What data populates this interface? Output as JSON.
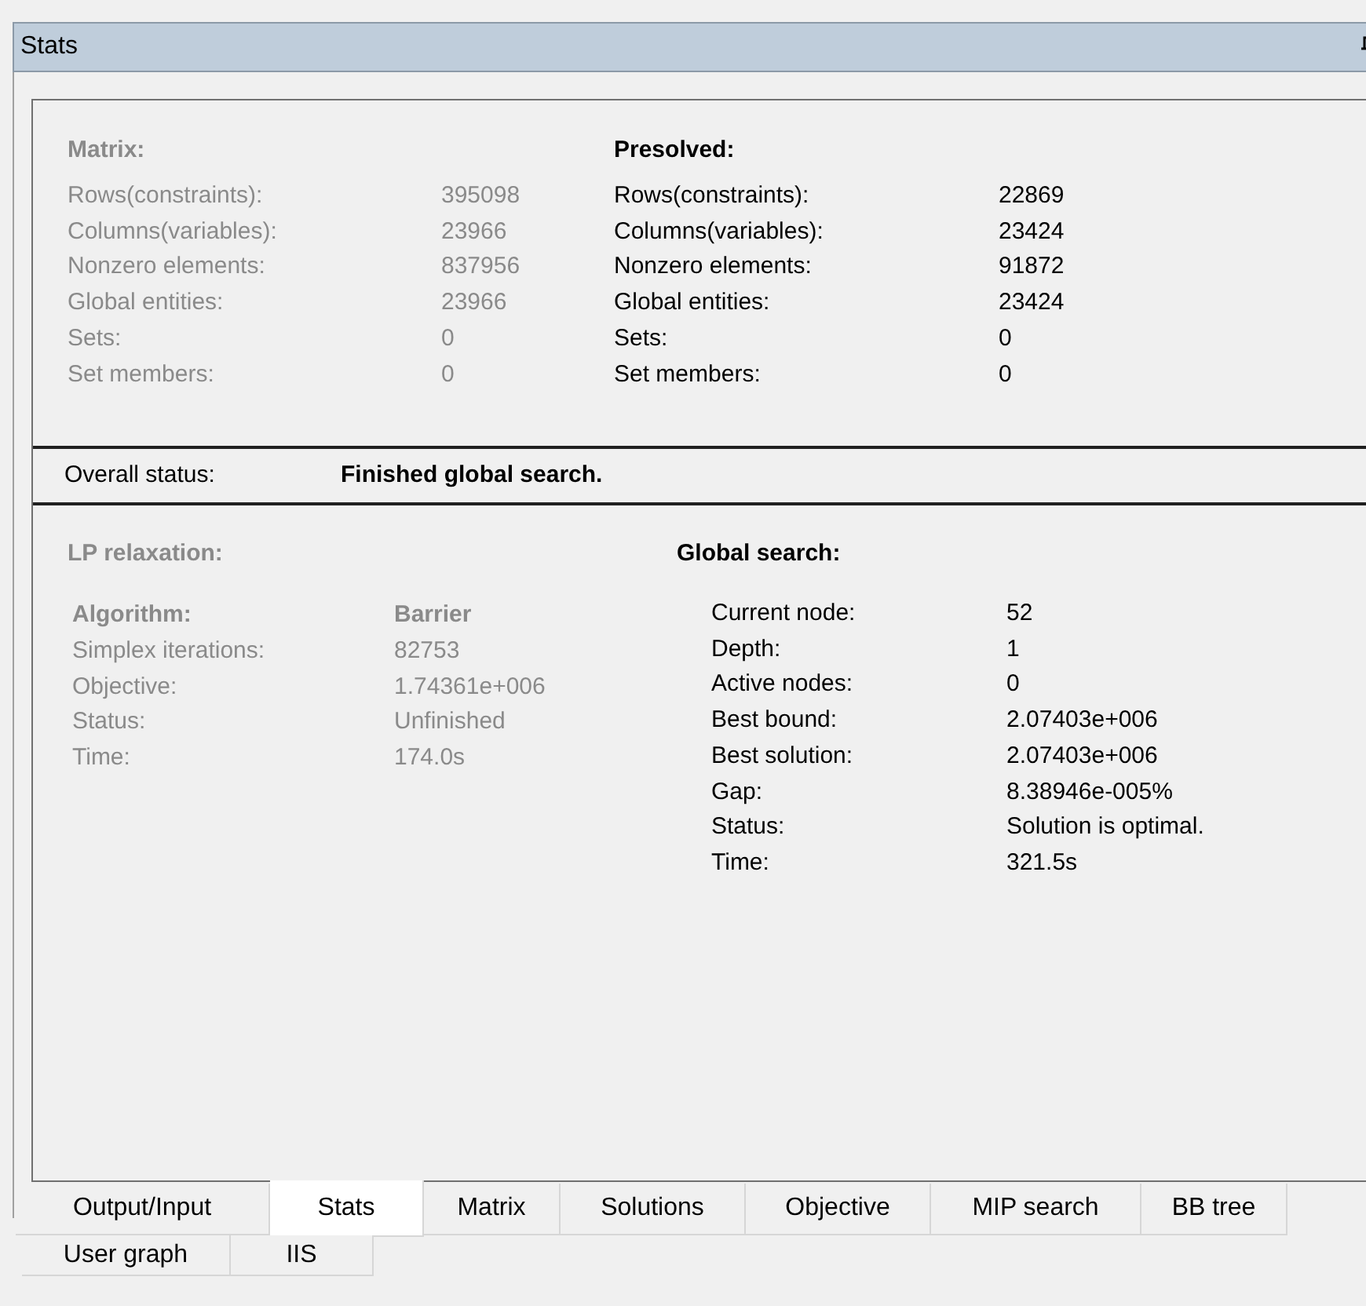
{
  "panel": {
    "title": "Stats"
  },
  "matrix": {
    "title": "Matrix:",
    "disabled": true,
    "rows": [
      {
        "label": "Rows(constraints):",
        "value": "395098"
      },
      {
        "label": "Columns(variables):",
        "value": "23966"
      },
      {
        "label": "Nonzero elements:",
        "value": "837956"
      },
      {
        "label": "Global entities:",
        "value": "23966"
      },
      {
        "label": "Sets:",
        "value": "0"
      },
      {
        "label": "Set members:",
        "value": "0"
      }
    ]
  },
  "presolved": {
    "title": "Presolved:",
    "disabled": false,
    "rows": [
      {
        "label": "Rows(constraints):",
        "value": "22869"
      },
      {
        "label": "Columns(variables):",
        "value": "23424"
      },
      {
        "label": "Nonzero elements:",
        "value": "91872"
      },
      {
        "label": "Global entities:",
        "value": "23424"
      },
      {
        "label": "Sets:",
        "value": "0"
      },
      {
        "label": "Set members:",
        "value": "0"
      }
    ]
  },
  "overall_status": {
    "label": "Overall status:",
    "value": "Finished global search."
  },
  "lp_relaxation": {
    "title": "LP relaxation:",
    "disabled": true,
    "header": {
      "label": "Algorithm:",
      "value": "Barrier"
    },
    "rows": [
      {
        "label": "Simplex iterations:",
        "value": "82753"
      },
      {
        "label": "Objective:",
        "value": "1.74361e+006"
      },
      {
        "label": "Status:",
        "value": "Unfinished"
      },
      {
        "label": "Time:",
        "value": "174.0s"
      }
    ]
  },
  "global_search": {
    "title": "Global search:",
    "disabled": false,
    "rows": [
      {
        "label": "Current node:",
        "value": "52"
      },
      {
        "label": "Depth:",
        "value": "1"
      },
      {
        "label": "Active nodes:",
        "value": "0"
      },
      {
        "label": "Best bound:",
        "value": "2.07403e+006"
      },
      {
        "label": "Best solution:",
        "value": "2.07403e+006"
      },
      {
        "label": "Gap:",
        "value": "8.38946e-005%"
      },
      {
        "label": "Status:",
        "value": "Solution is optimal."
      },
      {
        "label": "Time:",
        "value": "321.5s"
      }
    ]
  },
  "tab_rows": [
    [
      {
        "label": "Output/Input",
        "selected": false
      },
      {
        "label": "Stats",
        "selected": true
      },
      {
        "label": "Matrix",
        "selected": false
      },
      {
        "label": "Solutions",
        "selected": false
      },
      {
        "label": "Objective",
        "selected": false
      },
      {
        "label": "MIP search",
        "selected": false
      },
      {
        "label": "BB tree",
        "selected": false
      }
    ],
    [
      {
        "label": "User graph",
        "selected": false
      },
      {
        "label": "IIS",
        "selected": false
      }
    ]
  ]
}
